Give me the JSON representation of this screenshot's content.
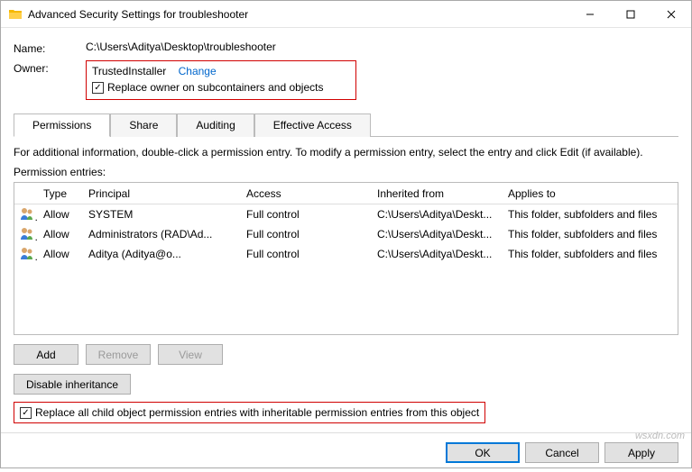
{
  "window": {
    "title": "Advanced Security Settings for troubleshooter"
  },
  "fields": {
    "name_label": "Name:",
    "name_value": "C:\\Users\\Aditya\\Desktop\\troubleshooter",
    "owner_label": "Owner:",
    "owner_value": "TrustedInstaller",
    "change_link": "Change",
    "replace_owner_label": "Replace owner on subcontainers and objects"
  },
  "tabs": {
    "t0": "Permissions",
    "t1": "Share",
    "t2": "Auditing",
    "t3": "Effective Access"
  },
  "info_text": "For additional information, double-click a permission entry. To modify a permission entry, select the entry and click Edit (if available).",
  "list_label": "Permission entries:",
  "columns": {
    "type": "Type",
    "principal": "Principal",
    "access": "Access",
    "inherited": "Inherited from",
    "applies": "Applies to"
  },
  "rows": [
    {
      "type": "Allow",
      "principal": "SYSTEM",
      "access": "Full control",
      "inherited": "C:\\Users\\Aditya\\Deskt...",
      "applies": "This folder, subfolders and files"
    },
    {
      "type": "Allow",
      "principal": "Administrators (RAD\\Ad...",
      "access": "Full control",
      "inherited": "C:\\Users\\Aditya\\Deskt...",
      "applies": "This folder, subfolders and files"
    },
    {
      "type": "Allow",
      "principal": "Aditya (Aditya@o...",
      "access": "Full control",
      "inherited": "C:\\Users\\Aditya\\Deskt...",
      "applies": "This folder, subfolders and files"
    }
  ],
  "buttons": {
    "add": "Add",
    "remove": "Remove",
    "view": "View",
    "disable_inheritance": "Disable inheritance",
    "ok": "OK",
    "cancel": "Cancel",
    "apply": "Apply"
  },
  "replace_all_label": "Replace all child object permission entries with inheritable permission entries from this object",
  "watermark": "wsxdn.com"
}
